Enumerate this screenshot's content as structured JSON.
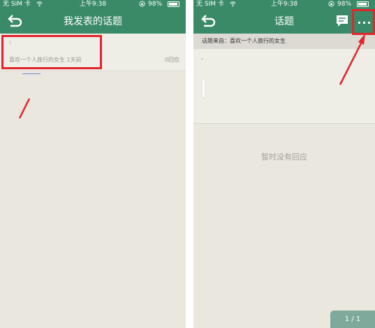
{
  "colors": {
    "nav_green": "#3a8a67",
    "background": "#e9e7de",
    "highlight_red": "#e2252d"
  },
  "status_bar": {
    "carrier": "无 SIM 卡",
    "time": "上午9:38",
    "battery": "98%",
    "battery_level": 0.98
  },
  "left_screen": {
    "nav": {
      "title": "我发表的话题",
      "back_icon": "back-arrow-icon"
    },
    "topic": {
      "content": ":",
      "meta": "喜欢一个人旅行的女生 1天前",
      "replies": "0回应"
    }
  },
  "right_screen": {
    "nav": {
      "title": "话题",
      "back_icon": "back-arrow-icon",
      "comment_icon": "comment-icon",
      "more_label": "..."
    },
    "source": "话题来自：喜欢一个人旅行的女生",
    "post_content": ".",
    "empty_message": "暂时没有回应",
    "pagination": "1 / 1"
  }
}
